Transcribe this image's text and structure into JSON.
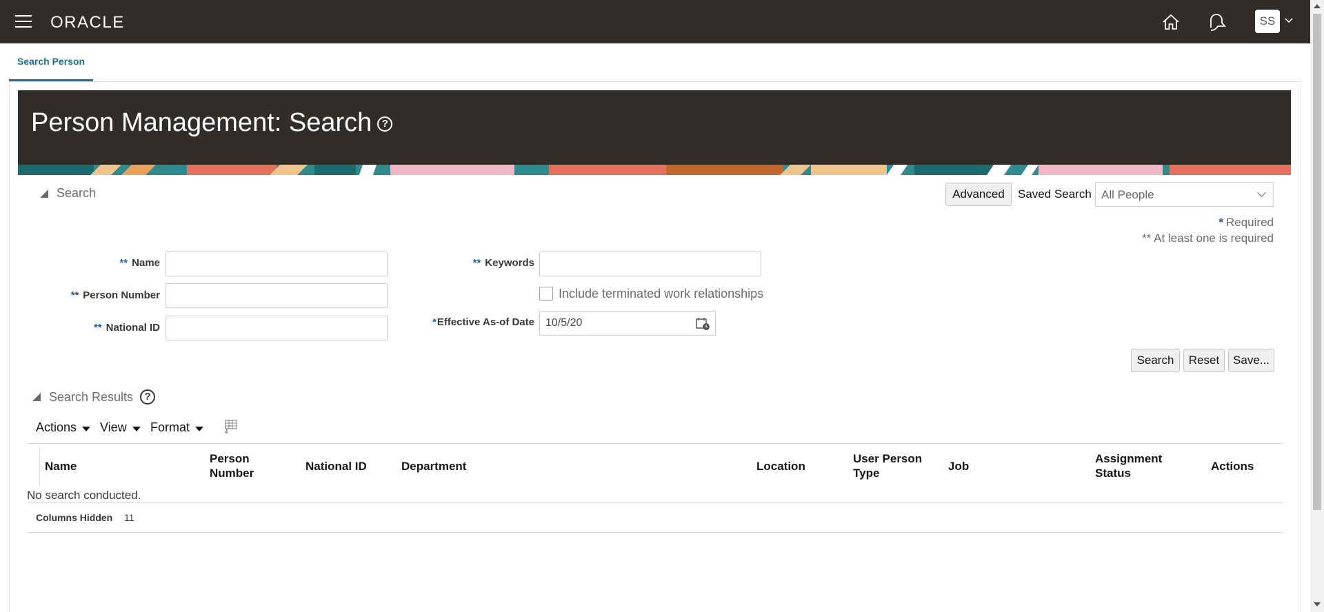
{
  "topbar": {
    "logo": "ORACLE",
    "avatar_initials": "SS",
    "icons": [
      "menu-icon",
      "home-icon",
      "notifications-icon",
      "chevron-down-icon"
    ]
  },
  "tabs": [
    {
      "label": "Search Person"
    }
  ],
  "header": {
    "title": "Person Management: Search",
    "help_glyph": "?"
  },
  "search": {
    "section_label": "Search",
    "advanced_label": "Advanced",
    "saved_search_label": "Saved Search",
    "saved_search_value": "All People",
    "required_note": "Required",
    "at_least_one_note": "** At least one is required",
    "fields": {
      "name_label": "Name",
      "person_number_label": "Person Number",
      "national_id_label": "National ID",
      "keywords_label": "Keywords",
      "include_terminated_label": "Include terminated work relationships",
      "effective_date_label": "Effective As-of Date",
      "effective_date_value": "10/5/20"
    },
    "required_marks": {
      "single": "*",
      "double": "**"
    },
    "buttons": {
      "search": "Search",
      "reset": "Reset",
      "save": "Save..."
    }
  },
  "results": {
    "section_label": "Search Results",
    "help_glyph": "?",
    "toolbar": {
      "actions": "Actions",
      "view": "View",
      "format": "Format"
    },
    "columns": [
      "Name",
      "Person Number",
      "National ID",
      "Department",
      "Location",
      "User Person Type",
      "Job",
      "Assignment Status",
      "Actions"
    ],
    "empty_message": "No search conducted.",
    "columns_hidden_label": "Columns Hidden",
    "columns_hidden_count": "11"
  },
  "colors": {
    "brand_bar": "#312d2a",
    "accent": "#1b6f92",
    "required_mark": "#1d5c8f"
  }
}
